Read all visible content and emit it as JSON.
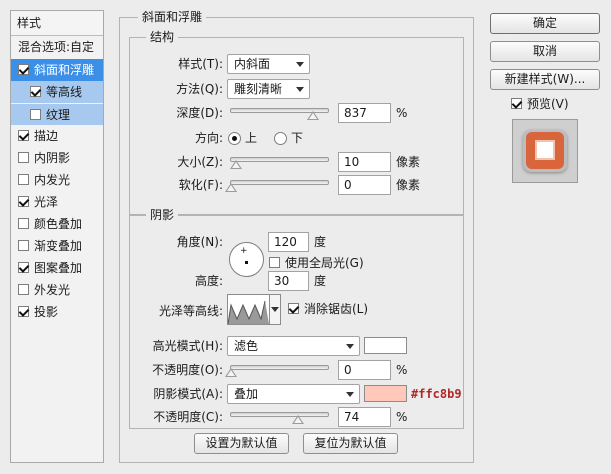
{
  "styles_panel": {
    "title": "样式",
    "items": [
      {
        "label": "混合选项:自定",
        "has_checkbox": false,
        "checked": false
      },
      {
        "label": "斜面和浮雕",
        "has_checkbox": true,
        "checked": true
      },
      {
        "label": "等高线",
        "has_checkbox": true,
        "checked": true
      },
      {
        "label": "纹理",
        "has_checkbox": true,
        "checked": false
      },
      {
        "label": "描边",
        "has_checkbox": true,
        "checked": true
      },
      {
        "label": "内阴影",
        "has_checkbox": true,
        "checked": false
      },
      {
        "label": "内发光",
        "has_checkbox": true,
        "checked": false
      },
      {
        "label": "光泽",
        "has_checkbox": true,
        "checked": true
      },
      {
        "label": "颜色叠加",
        "has_checkbox": true,
        "checked": false
      },
      {
        "label": "渐变叠加",
        "has_checkbox": true,
        "checked": false
      },
      {
        "label": "图案叠加",
        "has_checkbox": true,
        "checked": true
      },
      {
        "label": "外发光",
        "has_checkbox": true,
        "checked": false
      },
      {
        "label": "投影",
        "has_checkbox": true,
        "checked": true
      }
    ]
  },
  "bevel": {
    "title": "斜面和浮雕",
    "structure": {
      "title": "结构",
      "style_label": "样式(T):",
      "style_value": "内斜面",
      "technique_label": "方法(Q):",
      "technique_value": "雕刻清晰",
      "depth_label": "深度(D):",
      "depth_value": "837",
      "depth_level": 0.9,
      "depth_unit": "%",
      "direction_label": "方向:",
      "direction_up": "上",
      "direction_down": "下",
      "direction_selected": "up",
      "size_label": "大小(Z):",
      "size_value": "10",
      "size_level": 0.05,
      "size_unit": "像素",
      "soften_label": "软化(F):",
      "soften_value": "0",
      "soften_level": 0.0,
      "soften_unit": "像素"
    },
    "shading": {
      "title": "阴影",
      "angle_label": "角度(N):",
      "angle_value": "120",
      "angle_unit": "度",
      "global_light_label": "使用全局光(G)",
      "global_light_checked": false,
      "altitude_label": "高度:",
      "altitude_value": "30",
      "altitude_unit": "度",
      "gloss_contour_label": "光泽等高线:",
      "anti_aliased_label": "消除锯齿(L)",
      "anti_aliased_checked": true,
      "highlight_mode_label": "高光模式(H):",
      "highlight_mode_value": "滤色",
      "highlight_color": "#ffffff",
      "highlight_opacity_label": "不透明度(O):",
      "highlight_opacity_value": "0",
      "highlight_opacity_level": 0.0,
      "highlight_opacity_unit": "%",
      "shadow_mode_label": "阴影模式(A):",
      "shadow_mode_value": "叠加",
      "shadow_color": "#ffc8b9",
      "shadow_color_hex": "#ffc8b9",
      "shadow_opacity_label": "不透明度(C):",
      "shadow_opacity_value": "74",
      "shadow_opacity_level": 0.74,
      "shadow_opacity_unit": "%"
    },
    "make_default": "设置为默认值",
    "reset_default": "复位为默认值"
  },
  "actions": {
    "ok": "确定",
    "cancel": "取消",
    "new_style": "新建样式(W)...",
    "preview_label": "预览(V)",
    "preview_checked": true
  },
  "colors": {
    "accent": "#3c8fe6",
    "sub_selected": "#a7c9ef",
    "preview_orange": "#d9653c",
    "hex_text": "#b3272a"
  },
  "icons": {
    "dropdown": "chevron-down-icon",
    "checkbox": "checkmark-icon",
    "contour": "contour-curve-icon"
  }
}
